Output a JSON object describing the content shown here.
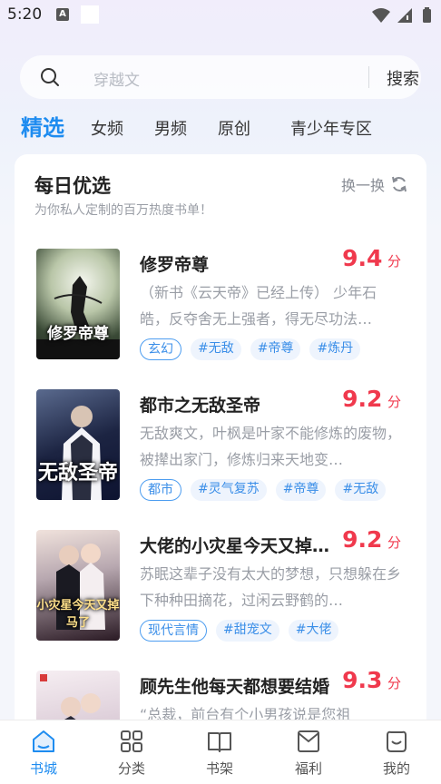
{
  "status": {
    "time": "5:20",
    "a_badge": "A"
  },
  "search": {
    "placeholder": "穿越文",
    "button": "搜索"
  },
  "tabs": [
    "精选",
    "女频",
    "男频",
    "原创",
    "青少年专区"
  ],
  "daily": {
    "title": "每日优选",
    "subtitle": "为你私人定制的百万热度书单！",
    "refresh": "换一换"
  },
  "books": [
    {
      "title": "修罗帝尊",
      "score": "9.4",
      "score_unit": "分",
      "desc": "（新书《云天帝》已经上传） 少年石皓，反夺舍无上强者，得无尽功法…",
      "category": "玄幻",
      "tags": [
        "#无敌",
        "#帝尊",
        "#炼丹"
      ],
      "cover_text": "修罗帝尊"
    },
    {
      "title": "都市之无敌圣帝",
      "score": "9.2",
      "score_unit": "分",
      "desc": "无敌爽文，叶枫是叶家不能修炼的废物，被撵出家门，修炼归来天地变…",
      "category": "都市",
      "tags": [
        "#灵气复苏",
        "#帝尊",
        "#无敌"
      ],
      "cover_text": "无敌圣帝"
    },
    {
      "title": "大佬的小灾星今天又掉马了",
      "score": "9.2",
      "score_unit": "分",
      "desc": "苏眠这辈子没有太大的梦想，只想躲在乡下种种田摘花，过闲云野鹤的…",
      "category": "现代言情",
      "tags": [
        "#甜宠文",
        "#大佬"
      ],
      "cover_text": "小灾星今天又掉马了"
    },
    {
      "title": "顾先生他每天都想要结婚",
      "score": "9.3",
      "score_unit": "分",
      "desc": "“总裁，前台有个小男孩说是您祖",
      "category": "",
      "tags": [],
      "cover_text": ""
    }
  ],
  "nav": [
    "书城",
    "分类",
    "书架",
    "福利",
    "我的"
  ],
  "colors": {
    "accent": "#1e8cf0",
    "score": "#f0394d"
  }
}
